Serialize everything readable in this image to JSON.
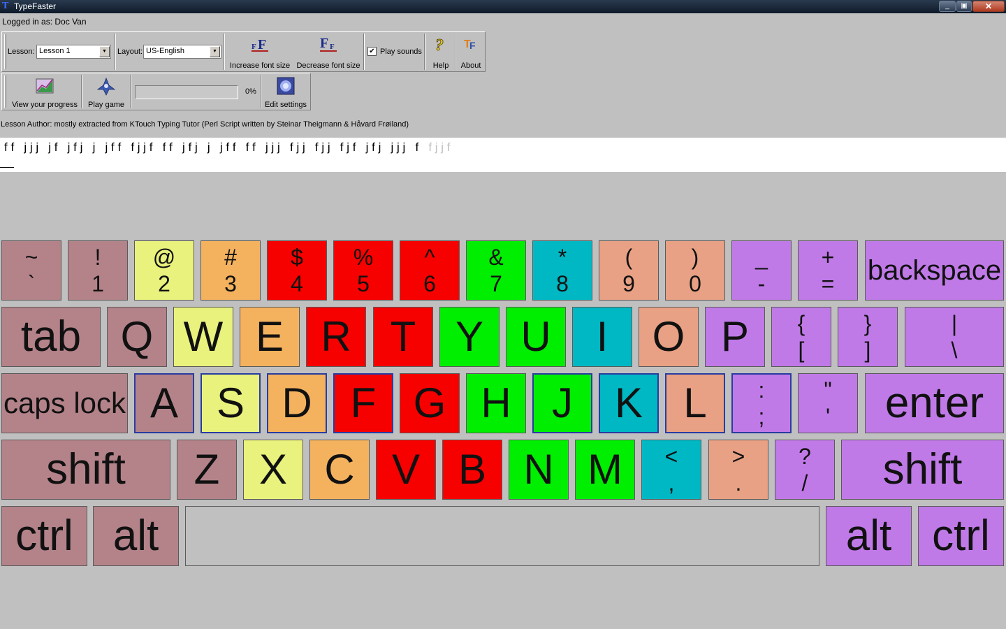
{
  "window": {
    "title": "TypeFaster",
    "min": "_",
    "max": "▣",
    "close": "✕"
  },
  "login": "Logged in as: Doc Van",
  "toolbar1": {
    "lesson_label": "Lesson:",
    "lesson_value": "Lesson 1",
    "layout_label": "Layout:",
    "layout_value": "US-English",
    "increase_font": "Increase font size",
    "decrease_font": "Decrease font size",
    "play_sounds": "Play sounds",
    "help": "Help",
    "about": "About"
  },
  "toolbar2": {
    "view_progress": "View your progress",
    "play_game": "Play game",
    "progress_percent": "0%",
    "progress_value": 0,
    "edit_settings": "Edit settings"
  },
  "author": "Lesson Author: mostly extracted from KTouch Typing Tutor (Perl Script written by Steinar Theigmann & Håvard Frøiland)",
  "lesson": {
    "text_main": "f f   j j j   j f   j f j   j   j f f   f j j f   f f   j f j   j   j f f   f f   j j j   f j j   f j j   f j f   j f j   j j j   f  ",
    "text_upcoming": " f j j f"
  },
  "keys": {
    "r0": [
      {
        "top": "~",
        "bot": "`"
      },
      {
        "top": "!",
        "bot": "1"
      },
      {
        "top": "@",
        "bot": "2"
      },
      {
        "top": "#",
        "bot": "3"
      },
      {
        "top": "$",
        "bot": "4"
      },
      {
        "top": "%",
        "bot": "5"
      },
      {
        "top": "^",
        "bot": "6"
      },
      {
        "top": "&",
        "bot": "7"
      },
      {
        "top": "*",
        "bot": "8"
      },
      {
        "top": "(",
        "bot": "9"
      },
      {
        "top": ")",
        "bot": "0"
      },
      {
        "top": "_",
        "bot": "-"
      },
      {
        "top": "+",
        "bot": "="
      },
      {
        "label": "backspace"
      }
    ],
    "r1": [
      {
        "label": "tab"
      },
      {
        "label": "Q"
      },
      {
        "label": "W"
      },
      {
        "label": "E"
      },
      {
        "label": "R"
      },
      {
        "label": "T"
      },
      {
        "label": "Y"
      },
      {
        "label": "U"
      },
      {
        "label": "I"
      },
      {
        "label": "O"
      },
      {
        "label": "P"
      },
      {
        "top": "{",
        "bot": "["
      },
      {
        "top": "}",
        "bot": "]"
      },
      {
        "top": "|",
        "bot": "\\"
      }
    ],
    "r2": [
      {
        "label": "caps lock"
      },
      {
        "label": "A"
      },
      {
        "label": "S"
      },
      {
        "label": "D"
      },
      {
        "label": "F"
      },
      {
        "label": "G"
      },
      {
        "label": "H"
      },
      {
        "label": "J"
      },
      {
        "label": "K"
      },
      {
        "label": "L"
      },
      {
        "top": ":",
        "bot": ";"
      },
      {
        "top": "\"",
        "bot": "'"
      },
      {
        "label": "enter"
      }
    ],
    "r3": [
      {
        "label": "shift"
      },
      {
        "label": "Z"
      },
      {
        "label": "X"
      },
      {
        "label": "C"
      },
      {
        "label": "V"
      },
      {
        "label": "B"
      },
      {
        "label": "N"
      },
      {
        "label": "M"
      },
      {
        "top": "<",
        "bot": ","
      },
      {
        "top": ">",
        "bot": "."
      },
      {
        "top": "?",
        "bot": "/"
      },
      {
        "label": "shift"
      }
    ],
    "r4": [
      {
        "label": "ctrl"
      },
      {
        "label": "alt"
      },
      {
        "label": "alt"
      },
      {
        "label": "ctrl"
      }
    ]
  },
  "colors": {
    "rose": "#b4838a",
    "yellow": "#e8f27c",
    "orange": "#f4b25e",
    "red": "#f60000",
    "green": "#00ee00",
    "teal": "#00b8c4",
    "salmon": "#e8a184",
    "violet": "#c07ae8",
    "home_border": "#2a3ca0"
  },
  "icons": [
    "increase-font-icon",
    "decrease-font-icon",
    "help-icon",
    "about-icon",
    "progress-chart-icon",
    "game-icon",
    "settings-icon"
  ]
}
